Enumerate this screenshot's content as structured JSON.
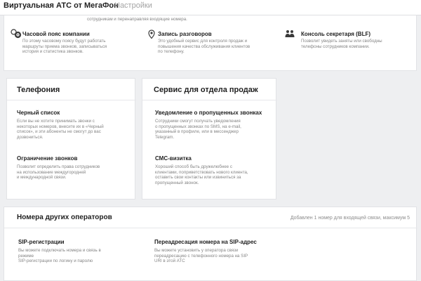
{
  "header": {
    "app_title": "Виртуальная АТС от МегаФон",
    "separator": "›",
    "current_page": "Настройки"
  },
  "features": {
    "top_desc": "сотрудникам и перенаправляя входящие номера.",
    "items": [
      {
        "title": "Часовой пояс компании",
        "desc_lines": [
          "По этому часовому поясу будут работать",
          "маршруты приема звонков, записываться",
          "история и статистика звонков."
        ]
      },
      {
        "title": "Запись разговоров",
        "desc_lines": [
          "Это удобный сервис для контроля продаж и",
          "повышения качества обслуживания клиентов",
          "по телефону."
        ]
      },
      {
        "title": "Консоль секретаря (BLF)",
        "desc_lines": [
          "Позволит увидеть заняты или свободны",
          "телефоны сотрудников компании."
        ]
      }
    ]
  },
  "telephony": {
    "title": "Телефония",
    "items": [
      {
        "title": "Черный список",
        "desc_lines": [
          "Если вы не хотите принимать звонки с",
          "некоторых номеров, внесите их в «Черный",
          "список», и эти абоненты не смогут до вас",
          "дозвониться."
        ]
      },
      {
        "title": "Ограничение звонков",
        "desc_lines": [
          "Позволит определить права сотрудников",
          "на использование междугородней",
          "и международной связи."
        ]
      }
    ]
  },
  "sales": {
    "title": "Сервис для отдела продаж",
    "items": [
      {
        "title": "Уведомление о пропущенных звонках",
        "desc_lines": [
          "Сотрудники смогут получать уведомления",
          "о пропущенных звонках по SMS, на e-mail,",
          "указанный в профиле, или в мессенджер",
          "Telegram."
        ]
      },
      {
        "title": "СМС-визитка",
        "desc_lines": [
          "Хороший способ быть дружелюбнее с",
          "клиентами, поприветствовать нового клиента,",
          "оставить свои контакты или извиниться за",
          "пропущенный звонок."
        ]
      }
    ]
  },
  "operators": {
    "title": "Номера других операторов",
    "note": "Добавлен 1 номер для входящей связи, максимум 5",
    "items": [
      {
        "title": "SIP-регистрации",
        "desc_lines": [
          "Вы можете подключать номера и связь в",
          "режиме",
          "SIP-регистрации по логину и паролю"
        ]
      },
      {
        "title": "Переадресация номера на SIP-адрес",
        "desc_lines": [
          "Вы можете установить у оператора связи",
          "переадресацию с телефонного номера на SIP",
          "URI в этой АТС"
        ]
      }
    ]
  },
  "icons": {
    "timezone": "timezone-icon",
    "recording": "recording-pin-icon",
    "secretary": "secretary-console-icon",
    "top_item": "feature-icon"
  },
  "colors": {
    "background": "#eeeff1",
    "card": "#ffffff",
    "text": "#1f1f1f",
    "muted": "#858585"
  }
}
